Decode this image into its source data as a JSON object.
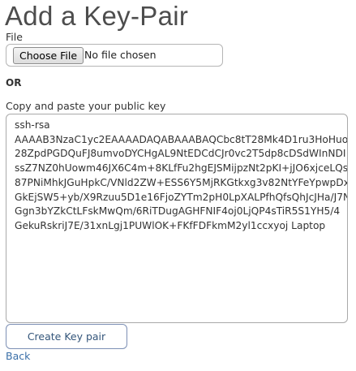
{
  "page": {
    "title": "Add a Key-Pair"
  },
  "file": {
    "label": "File",
    "button_label": "Choose File",
    "status": "No file chosen"
  },
  "or_label": "OR",
  "public_key": {
    "label": "Copy and paste your public key",
    "value": "ssh-rsa\nAAAAB3NzaC1yc2EAAAADAQABAAABAQCbc8tT28Mk4D1ru3HoHuo\n28ZpdPGDQuFJ8umvoDYCHgAL9NtEDCdCJr0vc2T5dp8cDSdWInNDI\nssZ7NZ0hUowm46JX6C4m+8KLfFu2hgEJSMijpzNt2pKI+jJO6xjceLQs\n87PNiMhkJGuHpkC/VNld2ZW+ESS6Y5MjRKGtkxg3v82NtYFeYpwpDx\nGkEjSW5+yb/X9Rzuu5D1e16FjoZYTm2pH0LpXALPfhQfsQhJcJHa/J7N\nGgn3bYZkCtLFskMwQm/6RiTDugAGHFNIF4oj0LjQP4sTiR5S1YH5/4\nGekuRskriJ7E/31xnLgj1PUWlOK+FKfFDFkmM2yl1ccxyoj Laptop"
  },
  "actions": {
    "create_label": "Create Key pair",
    "back_label": "Back"
  }
}
